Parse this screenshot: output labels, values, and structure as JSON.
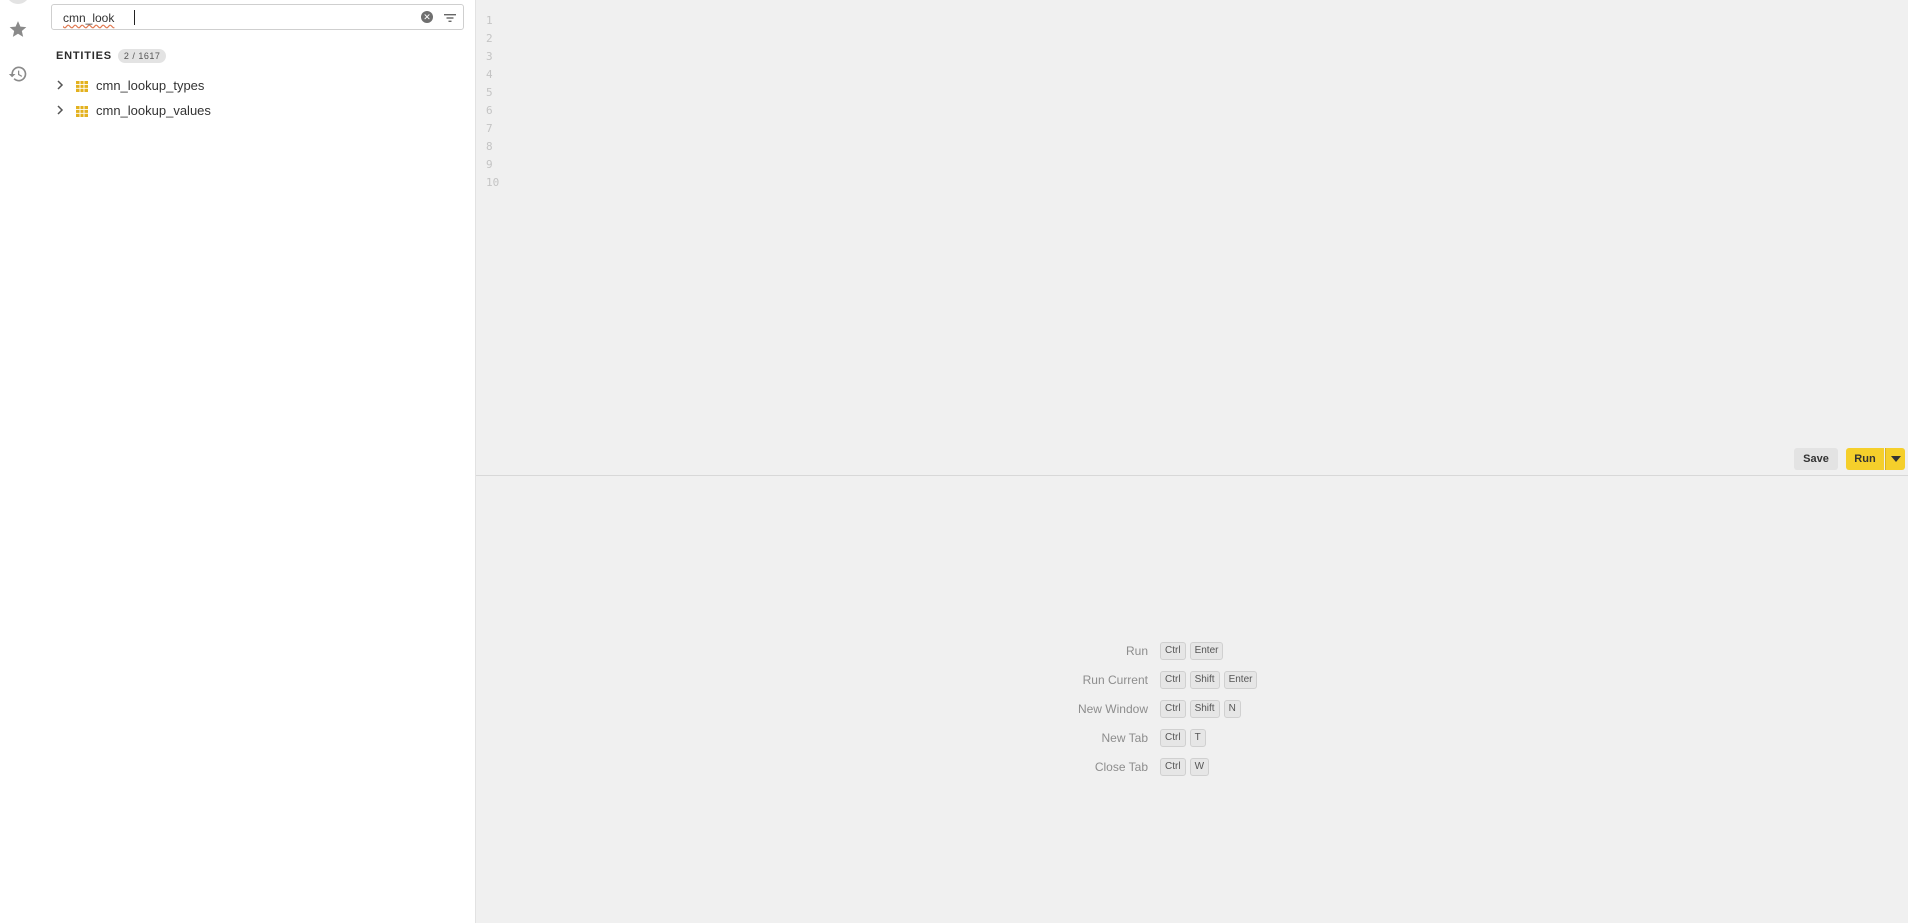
{
  "rail": {
    "items": [
      {
        "icon": "star-icon"
      },
      {
        "icon": "history-icon"
      }
    ]
  },
  "sidebar": {
    "search": {
      "value": "cmn_look",
      "placeholder": ""
    },
    "entities_title": "ENTITIES",
    "entities_count": "2 / 1617",
    "entities": [
      {
        "label": "cmn_lookup_types",
        "icon": "table-icon"
      },
      {
        "label": "cmn_lookup_values",
        "icon": "table-icon"
      }
    ]
  },
  "editor": {
    "line_numbers": [
      "1",
      "2",
      "3",
      "4",
      "5",
      "6",
      "7",
      "8",
      "9",
      "10"
    ],
    "save_label": "Save",
    "run_label": "Run"
  },
  "shortcuts": [
    {
      "label": "Run",
      "keys": [
        "Ctrl",
        "Enter"
      ]
    },
    {
      "label": "Run Current",
      "keys": [
        "Ctrl",
        "Shift",
        "Enter"
      ]
    },
    {
      "label": "New Window",
      "keys": [
        "Ctrl",
        "Shift",
        "N"
      ]
    },
    {
      "label": "New Tab",
      "keys": [
        "Ctrl",
        "T"
      ]
    },
    {
      "label": "Close Tab",
      "keys": [
        "Ctrl",
        "W"
      ]
    }
  ],
  "colors": {
    "accent": "#f5cf2b",
    "table_icon": "#e3b11e"
  }
}
